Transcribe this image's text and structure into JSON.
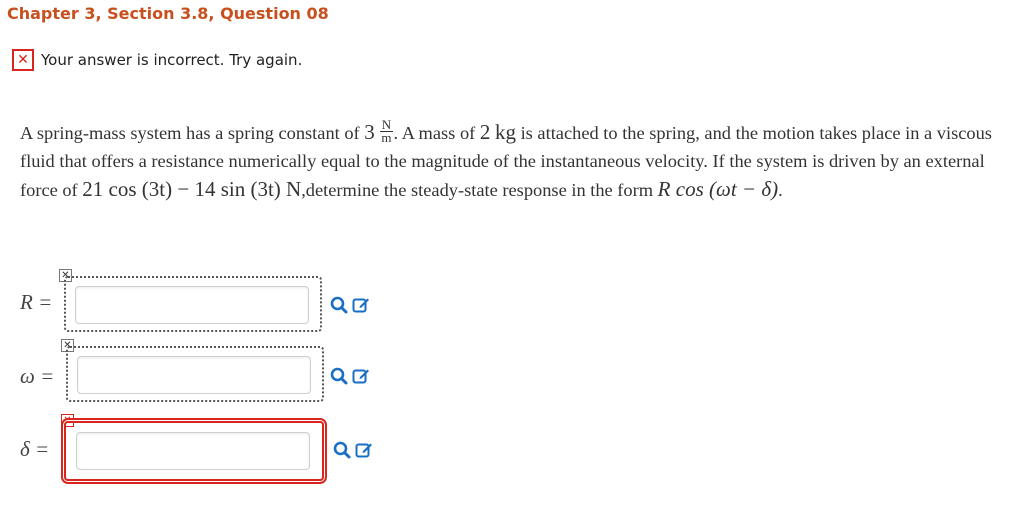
{
  "header": {
    "title": "Chapter 3, Section 3.8, Question 08"
  },
  "feedback": {
    "icon": "x-mark",
    "text": "Your answer is incorrect.  Try again."
  },
  "problem": {
    "part1": "A spring-mass system has a spring constant of ",
    "spring_constant": "3",
    "unit_num": "N",
    "unit_den": "m",
    "part2": ". A mass of ",
    "mass": "2",
    "mass_unit": "kg",
    "part3": " is attached to the spring, and the motion takes place in a viscous fluid that offers a resistance numerically equal to the magnitude of the instantaneous velocity. If the system is driven by an external force of ",
    "force": "21 cos (3t) − 14 sin (3t) N",
    "part4": ",determine the steady-state response in the form ",
    "form": "R cos (ωt − δ)",
    "part5": "."
  },
  "answers": [
    {
      "label": "R =",
      "value": "",
      "status": "unchecked"
    },
    {
      "label": "ω =",
      "value": "",
      "status": "unchecked"
    },
    {
      "label": "δ =",
      "value": "",
      "status": "incorrect"
    }
  ],
  "icons": {
    "search": "magnifier-icon",
    "edit": "pencil-square-icon",
    "accent": "#1a6fc4",
    "error": "#d9251d",
    "title_color": "#c8501e"
  }
}
